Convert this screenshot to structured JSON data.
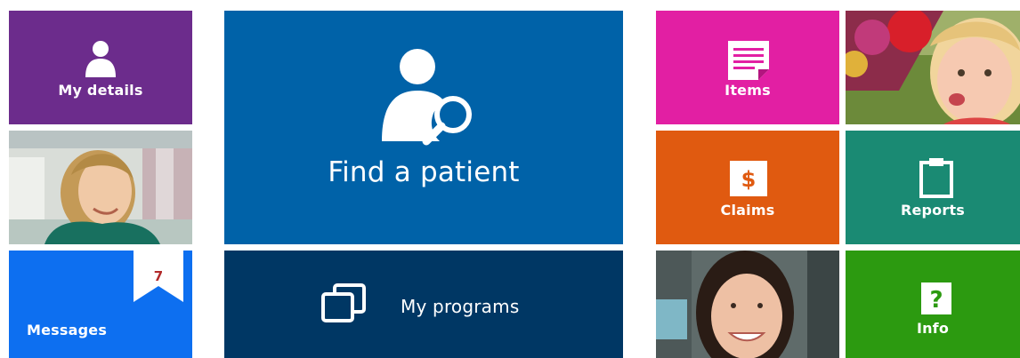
{
  "colors": {
    "my_details": "#6c2c8c",
    "messages": "#0d6ff0",
    "find_patient": "#0062a8",
    "my_programs": "#003764",
    "items": "#e21fa3",
    "claims": "#e05a10",
    "reports": "#1a8a73",
    "info": "#2c9a10"
  },
  "tiles": {
    "my_details": {
      "label": "My details",
      "icon": "person-icon"
    },
    "messages": {
      "label": "Messages",
      "badge": "7",
      "icon": "bookmark-badge-icon"
    },
    "find_patient": {
      "label": "Find a patient",
      "icon": "person-search-icon"
    },
    "my_programs": {
      "label": "My programs",
      "icon": "copy-windows-icon"
    },
    "items": {
      "label": "Items",
      "icon": "document-icon"
    },
    "claims": {
      "label": "Claims",
      "icon": "dollar-icon"
    },
    "reports": {
      "label": "Reports",
      "icon": "clipboard-icon"
    },
    "info": {
      "label": "Info",
      "icon": "question-icon"
    }
  }
}
